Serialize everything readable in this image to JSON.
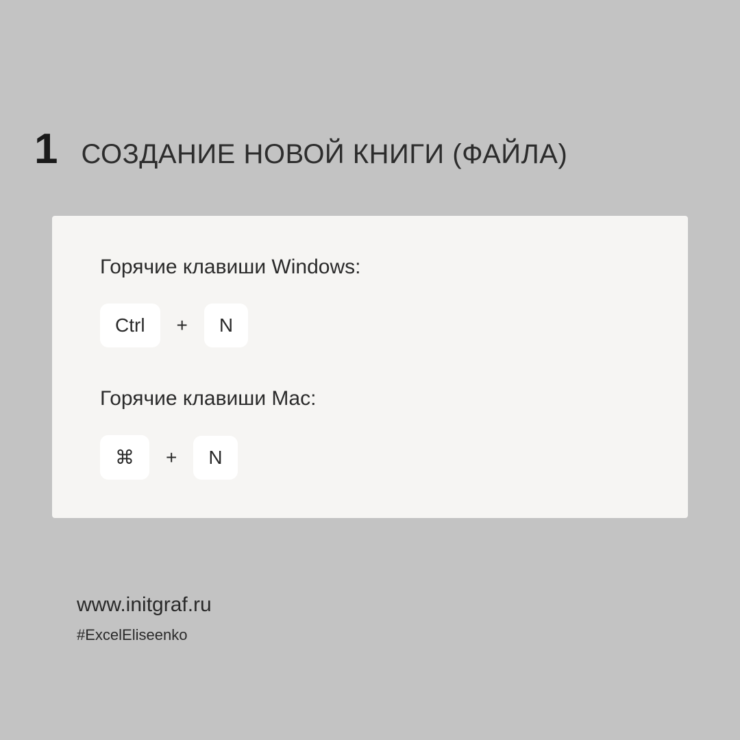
{
  "step_number": "1",
  "title": "СОЗДАНИЕ НОВОЙ КНИГИ (ФАЙЛА)",
  "shortcuts": {
    "windows": {
      "label": "Горячие клавиши Windows:",
      "key1": "Ctrl",
      "plus": "+",
      "key2": "N"
    },
    "mac": {
      "label": "Горячие клавиши Mac:",
      "key1": "⌘",
      "plus": "+",
      "key2": "N"
    }
  },
  "footer": {
    "website": "www.initgraf.ru",
    "hashtag": "#ExcelEliseenko"
  }
}
